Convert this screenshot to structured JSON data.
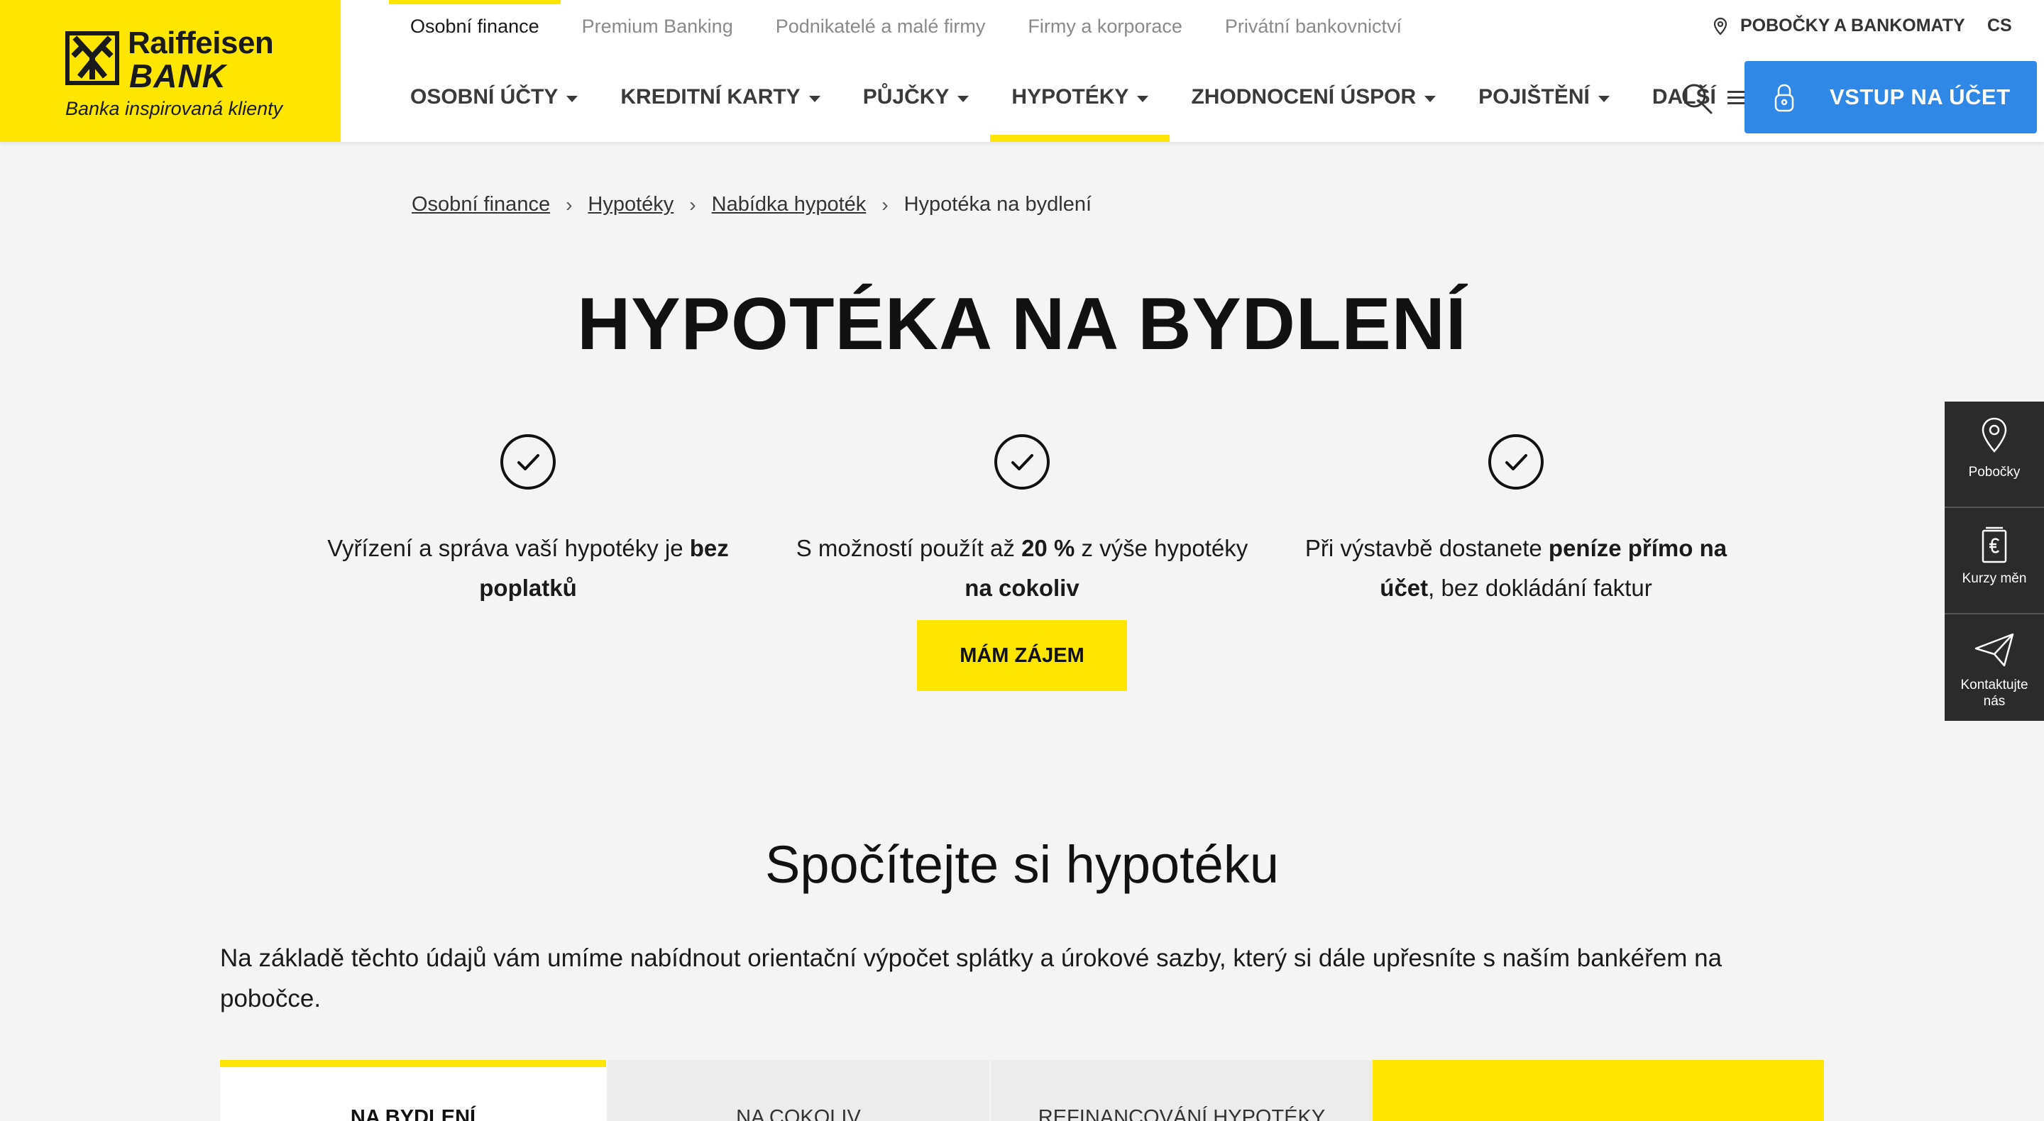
{
  "brand": {
    "name_line1": "Raiffeisen",
    "name_line2": "BANK",
    "tagline": "Banka inspirovaná klienty",
    "accent_color": "#fee600",
    "primary_blue": "#2f87e6"
  },
  "topnav": {
    "items": [
      {
        "label": "Osobní finance"
      },
      {
        "label": "Premium Banking"
      },
      {
        "label": "Podnikatelé a malé firmy"
      },
      {
        "label": "Firmy a korporace"
      },
      {
        "label": "Privátní bankovnictví"
      }
    ],
    "branches_label": "POBOČKY A BANKOMATY",
    "lang": "CS"
  },
  "mainnav": {
    "items": [
      {
        "label": "OSOBNÍ ÚČTY"
      },
      {
        "label": "KREDITNÍ KARTY"
      },
      {
        "label": "PŮJČKY"
      },
      {
        "label": "HYPOTÉKY"
      },
      {
        "label": "ZHODNOCENÍ ÚSPOR"
      },
      {
        "label": "POJIŠTĚNÍ"
      },
      {
        "label": "DALŠÍ"
      }
    ],
    "login_label": "VSTUP NA ÚČET"
  },
  "breadcrumb": {
    "items": [
      "Osobní finance",
      "Hypotéky",
      "Nabídka hypoték"
    ],
    "current": "Hypotéka na bydlení"
  },
  "hero": {
    "title": "HYPOTÉKA NA BYDLENÍ",
    "features": [
      {
        "pre": "Vyřízení a správa vaší hypotéky je ",
        "bold": "bez poplatků",
        "post": ""
      },
      {
        "pre": "S možností použít až ",
        "bold": "20 %",
        "mid": " z výše hypotéky ",
        "bold2": "na cokoliv"
      },
      {
        "pre": "Při výstavbě dostanete ",
        "bold": "peníze přímo na účet",
        "post": ", bez dokládání faktur"
      }
    ],
    "cta_label": "MÁM ZÁJEM"
  },
  "side_widget": {
    "items": [
      {
        "label": "Pobočky",
        "icon": "location-pin-icon"
      },
      {
        "label": "Kurzy měn",
        "icon": "euro-note-icon"
      },
      {
        "label": "Kontaktujte nás",
        "icon": "paper-plane-icon"
      }
    ]
  },
  "calculator": {
    "title": "Spočítejte si hypotéku",
    "description": "Na základě těchto údajů vám umíme nabídnout orientační výpočet splátky a úrokové sazby, který si dále upřesníte s naším bankéřem na pobočce.",
    "tabs": [
      {
        "label": "NA BYDLENÍ",
        "active": true
      },
      {
        "label": "NA COKOLIV",
        "active": false
      },
      {
        "label": "REFINANCOVÁNÍ HYPOTÉKY",
        "active": false
      }
    ]
  }
}
